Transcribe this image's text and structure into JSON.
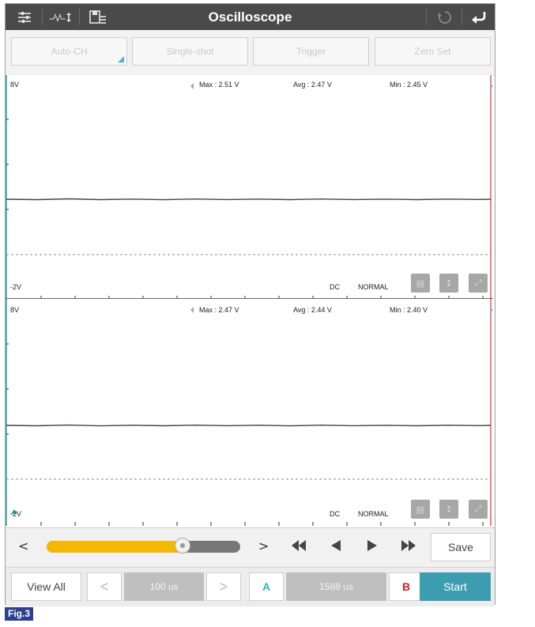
{
  "title": "Oscilloscope",
  "toolbar": {
    "left_icons": [
      "sliders-icon",
      "waveform-icon",
      "save-file-icon"
    ],
    "right_icons": [
      "refresh-icon",
      "back-icon"
    ]
  },
  "buttons": {
    "auto_ch": "Auto-CH",
    "single_shot": "Single-shot",
    "trigger": "Trigger",
    "zero_set": "Zero Set"
  },
  "channel1": {
    "top_label": "8V",
    "bottom_label": "-2V",
    "max": "Max : 2.51 V",
    "avg": "Avg : 2.47 V",
    "min": "Min : 2.45 V",
    "coupling": "DC",
    "mode": "NORMAL"
  },
  "channel2": {
    "top_label": "8V",
    "bottom_label": "-2V",
    "max": "Max : 2.47 V",
    "avg": "Avg : 2.44 V",
    "min": "Min : 2.40 V",
    "coupling": "DC",
    "mode": "NORMAL"
  },
  "controls": {
    "prev_glyph": "<",
    "next_glyph": ">",
    "slider_level_percent": 70,
    "save": "Save",
    "view_all": "View All",
    "timebase": "100 us",
    "cursor_a": "A",
    "cursor_delta": "1588 us",
    "cursor_b": "B",
    "start": "Start"
  },
  "colors": {
    "title_bar": "#4a4a4a",
    "accent": "#3c9db0",
    "slider_fill": "#f5b800",
    "cursor_a": "#28b8c8",
    "cursor_b": "#d02020",
    "marker_line": "#e03030"
  },
  "figure_caption": "Fig.3"
}
